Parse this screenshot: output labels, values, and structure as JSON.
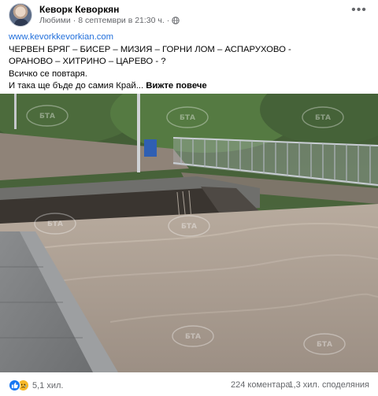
{
  "post": {
    "author": "Кеворк Кеворкян",
    "audience": "Любими",
    "timestamp": "8 септември в 21:30 ч.",
    "link": "www.kevorkkevorkian.com",
    "text_lines": [
      "ЧЕРВЕН БРЯГ – БИСЕР – МИЗИЯ – ГОРНИ ЛОМ – АСПАРУХОВО -",
      "ОРАНОВО – ХИТРИНО – ЦАРЕВО - ?",
      "Всичко се повтаря.",
      "И така ще бъде до самия Край..."
    ],
    "see_more": "Вижте повече",
    "watermark": "БТА"
  },
  "footer": {
    "reactions_count": "5,1 хил.",
    "comments": "224 коментара",
    "shares": "1,3 хил. споделяния"
  },
  "icons": {
    "more": "more-options-icon",
    "audience": "globe-icon",
    "like": "like-reaction-icon",
    "sad": "sad-reaction-icon"
  },
  "colors": {
    "link": "#216fdb",
    "like": "#1877f2",
    "sad": "#f7b928",
    "meta_text": "#65676b"
  }
}
